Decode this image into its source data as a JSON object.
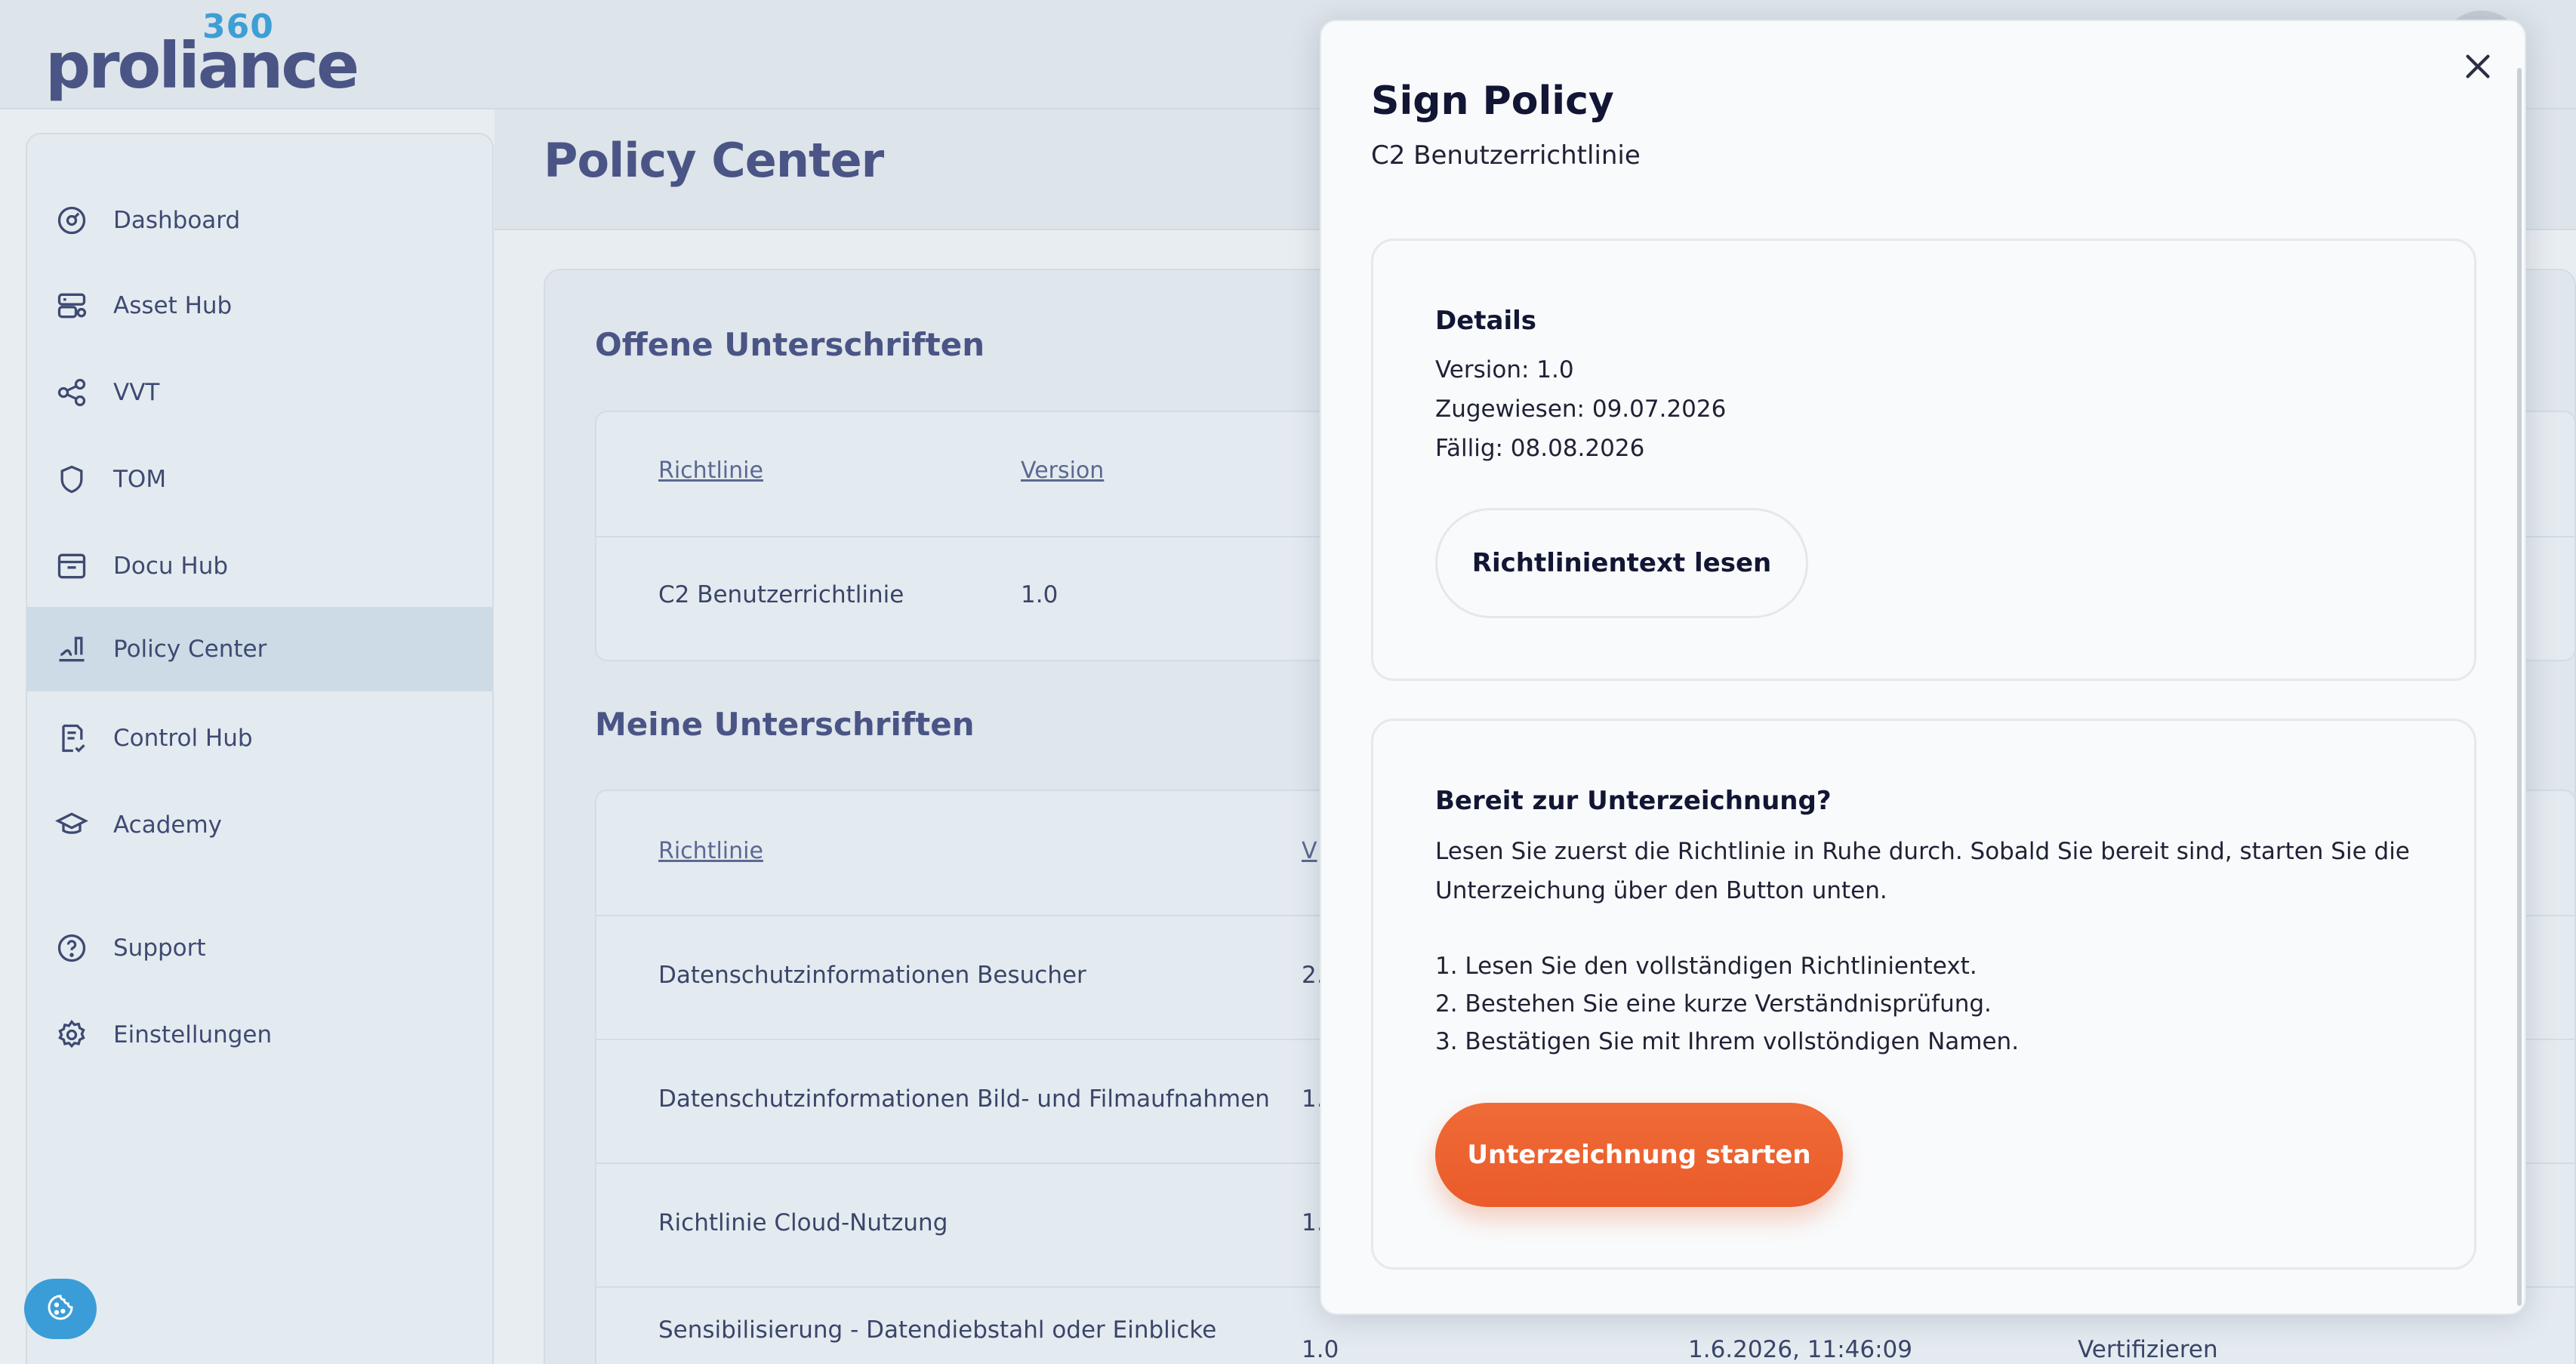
{
  "brand": {
    "logo_text": "proliance",
    "logo_superscript": "360"
  },
  "sidebar": {
    "items": [
      {
        "label": "Dashboard",
        "icon": "gauge-icon"
      },
      {
        "label": "Asset Hub",
        "icon": "server-icon"
      },
      {
        "label": "VVT",
        "icon": "share-icon"
      },
      {
        "label": "TOM",
        "icon": "shield-icon"
      },
      {
        "label": "Docu Hub",
        "icon": "archive-icon"
      },
      {
        "label": "Policy Center",
        "icon": "signature-icon",
        "active": true
      },
      {
        "label": "Control Hub",
        "icon": "checklist-icon"
      },
      {
        "label": "Academy",
        "icon": "graduation-cap-icon"
      },
      {
        "label": "Support",
        "icon": "help-icon"
      },
      {
        "label": "Einstellungen",
        "icon": "gear-icon"
      }
    ]
  },
  "page": {
    "title": "Policy Center",
    "open_section": {
      "title": "Offene Unterschriften",
      "columns": [
        "Richtlinie",
        "Version"
      ],
      "rows": [
        {
          "policy": "C2 Benutzerrichtlinie",
          "version": "1.0"
        }
      ]
    },
    "mine_section": {
      "title": "Meine Unterschriften",
      "columns": [
        "Richtlinie",
        "V"
      ],
      "rows": [
        {
          "policy": "Datenschutzinformationen Besucher",
          "version": "2."
        },
        {
          "policy": "Datenschutzinformationen Bild- und Filmaufnahmen",
          "version": "1.0"
        },
        {
          "policy": "Richtlinie Cloud-Nutzung",
          "version": "1.0"
        },
        {
          "policy": "Sensibilisierung - Datendiebstahl oder Einblicke",
          "version": "1.0",
          "date": "1.6.2026, 11:46:09",
          "action": "Vertifizieren"
        }
      ]
    }
  },
  "modal": {
    "title": "Sign Policy",
    "subtitle": "C2 Benutzerrichtlinie",
    "details": {
      "heading": "Details",
      "version": "Version: 1.0",
      "assigned": "Zugewiesen: 09.07.2026",
      "due": "Fällig: 08.08.2026",
      "read_button": "Richtlinientext lesen"
    },
    "ready": {
      "heading": "Bereit zur Unterzeichnung?",
      "intro_line1": "Lesen Sie zuerst die Richtlinie in Ruhe durch. Sobald Sie bereit sind, starten Sie die",
      "intro_line2": "Unterzeichung über den Button unten.",
      "step1": "1. Lesen Sie den vollständigen Richtlinientext.",
      "step2": "2. Bestehen Sie eine kurze Verständnisprüfung.",
      "step3": "3. Bestätigen Sie mit Ihrem vollstöndigen Namen.",
      "start_button": "Unterzeichnung starten"
    }
  },
  "colors": {
    "accent": "#3d9fd4",
    "primary_button": "#ea5b2a",
    "brand_text": "#4a5586"
  }
}
